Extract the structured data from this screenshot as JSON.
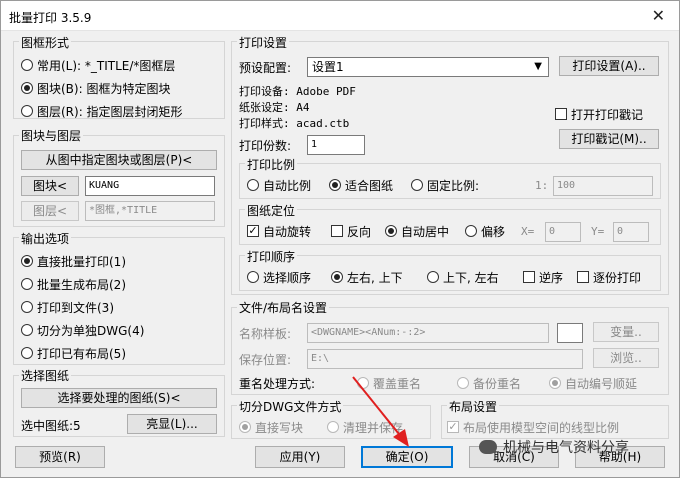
{
  "window": {
    "title": "批量打印 3.5.9",
    "close_icon": "✕"
  },
  "frame_form": {
    "label": "图框形式",
    "options": [
      {
        "label": "常用(L): *_TITLE/*图框层",
        "selected": false
      },
      {
        "label": "图块(B): 图框为特定图块",
        "selected": true
      },
      {
        "label": "图层(R): 指定图层封闭矩形",
        "selected": false
      }
    ]
  },
  "block_layer": {
    "label": "图块与图层",
    "pick_button": "从图中指定图块或图层(P)<",
    "block_button": "图块<",
    "block_value": "KUANG",
    "layer_button": "图层<",
    "layer_value": "*图框,*TITLE"
  },
  "output": {
    "label": "输出选项",
    "options": [
      {
        "label": "直接批量打印(1)",
        "selected": true
      },
      {
        "label": "批量生成布局(2)",
        "selected": false
      },
      {
        "label": "打印到文件(3)",
        "selected": false
      },
      {
        "label": "切分为单独DWG(4)",
        "selected": false
      },
      {
        "label": "打印已有布局(5)",
        "selected": false
      }
    ]
  },
  "select_sheets": {
    "label": "选择图纸",
    "button": "选择要处理的图纸(S)<",
    "count_label": "选中图纸:5",
    "highlight_button": "亮显(L)..."
  },
  "preview_button": "预览(R)",
  "print_settings": {
    "label": "打印设置",
    "preset_label": "预设配置:",
    "preset_value": "设置1",
    "settings_button": "打印设置(A)..",
    "device": "打印设备: Adobe PDF",
    "paper": "纸张设定: A4",
    "style": "打印样式: acad.ctb",
    "stamp_check": "打开打印戳记",
    "stamp_button": "打印戳记(M)..",
    "copies_label": "打印份数:",
    "copies_value": "1"
  },
  "scale": {
    "label": "打印比例",
    "options": [
      {
        "label": "自动比例",
        "selected": false
      },
      {
        "label": "适合图纸",
        "selected": true
      },
      {
        "label": "固定比例:",
        "selected": false
      }
    ],
    "ratio_prefix": "1:",
    "ratio_value": "100"
  },
  "position": {
    "label": "图纸定位",
    "auto_rotate": "自动旋转",
    "reverse": "反向",
    "center": "自动居中",
    "offset": "偏移",
    "x_label": "X=",
    "x_value": "0",
    "y_label": "Y=",
    "y_value": "0"
  },
  "order": {
    "label": "打印顺序",
    "options": [
      {
        "label": "选择顺序",
        "selected": false
      },
      {
        "label": "左右, 上下",
        "selected": true
      },
      {
        "label": "上下, 左右",
        "selected": false
      }
    ],
    "reverse": "逆序",
    "one_by_one": "逐份打印"
  },
  "file_naming": {
    "label": "文件/布局名设置",
    "template_label": "名称样板:",
    "template_value": "<DWGNAME><ANum:-:2>",
    "variable_button": "变量..",
    "save_label": "保存位置:",
    "save_value": "E:\\",
    "browse_button": "浏览..",
    "dup_label": "重名处理方式:",
    "dup_options": [
      {
        "label": "覆盖重名",
        "selected": false
      },
      {
        "label": "备份重名",
        "selected": false
      },
      {
        "label": "自动编号顺延",
        "selected": true
      }
    ]
  },
  "split_dwg": {
    "label": "切分DWG文件方式",
    "options": [
      {
        "label": "直接写块",
        "selected": true
      },
      {
        "label": "清理并保存",
        "selected": false
      }
    ]
  },
  "layout": {
    "label": "布局设置",
    "check": "布局使用模型空间的线型比例"
  },
  "footer": {
    "apply": "应用(Y)",
    "ok": "确定(O)",
    "cancel": "取消(C)",
    "help": "帮助(H)"
  },
  "watermark": "机械与电气资料分享"
}
